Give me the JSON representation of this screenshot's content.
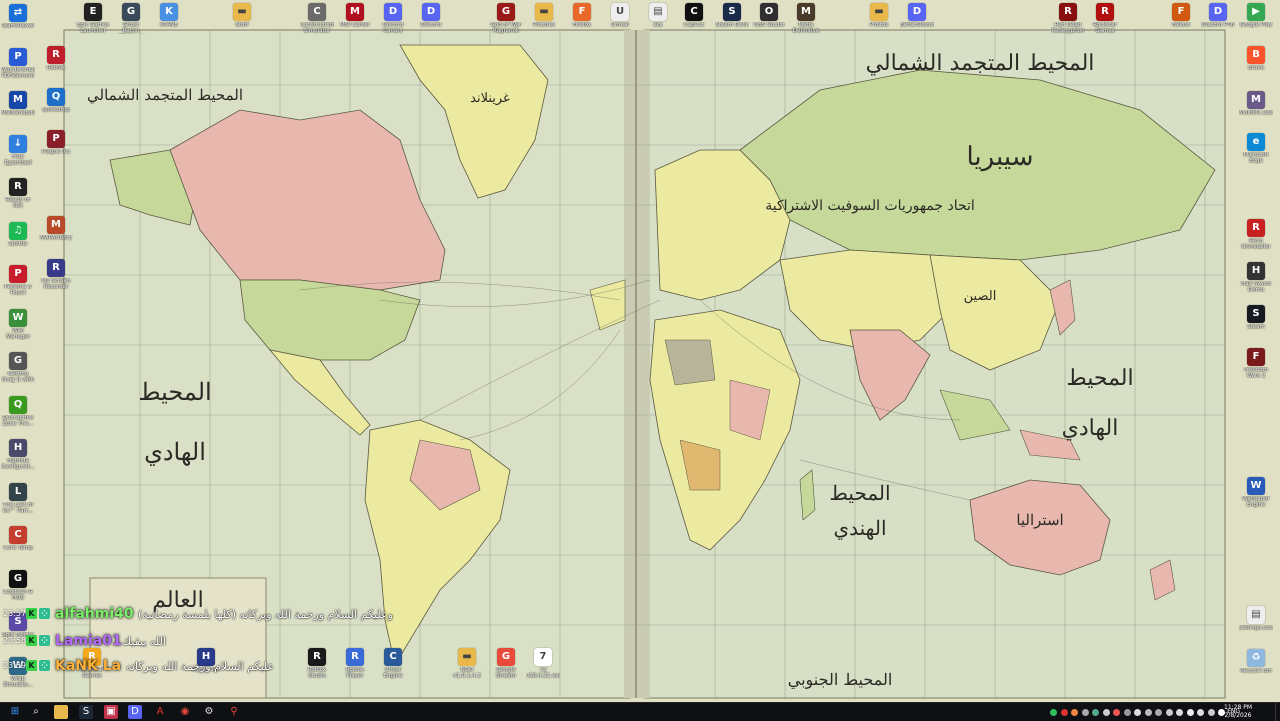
{
  "wallpaper": {
    "labels": {
      "north_atlantic": "المحيط المتجمد الشمالي",
      "north_atlantic_left": "المحيط المتجمد الشمالي",
      "greenland": "غرينلاند",
      "siberia": "سيبريا",
      "ussr": "اتحاد جمهوريات السوفيت الاشتراكية",
      "pacific_left_1": "المحيط",
      "pacific_left_2": "الهادي",
      "pacific_right_1": "المحيط",
      "pacific_right_2": "الهادي",
      "indian_1": "المحيط",
      "indian_2": "الهندي",
      "china": "الصين",
      "australia": "استراليا",
      "southern": "المحيط الجنوبي",
      "title": "العالم"
    }
  },
  "desktop_icons": {
    "left_col": [
      {
        "name": "teamviewer",
        "label": "TeamViewer",
        "color": "#1a6fd9",
        "glyph": "⇄"
      },
      {
        "name": "wondershare",
        "label": "Wondershare PDFelement",
        "color": "#2a5bd7",
        "glyph": "P"
      },
      {
        "name": "malwarebytes",
        "label": "Malwarebytes",
        "color": "#1747a8",
        "glyph": "M"
      },
      {
        "name": "free-download",
        "label": "Free Download Manager",
        "color": "#2f7fe0",
        "glyph": "↓"
      },
      {
        "name": "ready-or-not",
        "label": "Ready or Not",
        "color": "#222",
        "glyph": "R"
      },
      {
        "name": "spotify",
        "label": "Spotify",
        "color": "#1db954",
        "glyph": "♫"
      },
      {
        "name": "persona-5",
        "label": "Persona 5 Royal",
        "color": "#c81e2b",
        "glyph": "P"
      },
      {
        "name": "wiki-manager",
        "label": "Wiki Manager",
        "color": "#3a8f3a",
        "glyph": "W"
      },
      {
        "name": "getting-over-it",
        "label": "Getting Over It with Be...",
        "color": "#555",
        "glyph": "G"
      },
      {
        "name": "quarantine-zone",
        "label": "Quarantine Zone The...",
        "color": "#3a9a20",
        "glyph": "Q"
      },
      {
        "name": "hidhide",
        "label": "HidHide Configurat...",
        "color": "#4a4a6a",
        "glyph": "H"
      },
      {
        "name": "last-of-us",
        "label": "The Last of Us™ Part...",
        "color": "#33434a",
        "glyph": "L"
      },
      {
        "name": "core-temp",
        "label": "Core Temp",
        "color": "#c43d2f",
        "glyph": "C"
      },
      {
        "name": "logitech-g-hub",
        "label": "Logitech G HUB",
        "color": "#111",
        "glyph": "G"
      },
      {
        "name": "split-fiction",
        "label": "Split Fiction",
        "color": "#5b4aa8",
        "glyph": "S"
      },
      {
        "name": "wrap-sim",
        "label": "Wrap Simulato...",
        "color": "#2d6a8a",
        "glyph": "W"
      }
    ],
    "left_col2": [
      {
        "name": "roblox",
        "label": "Roblox",
        "color": "#c01e2a",
        "glyph": "R"
      },
      {
        "name": "quickdrop",
        "label": "quickdrop",
        "color": "#1e6fc8",
        "glyph": "Q"
      },
      {
        "name": "plaguii",
        "label": "Plague Inc",
        "color": "#8a1f2a",
        "glyph": "P"
      },
      {
        "name": "map-app",
        "label": "MAPArtistry",
        "color": "#b84a2a",
        "glyph": "M"
      },
      {
        "name": "my-screen",
        "label": "My Screen Recorder",
        "color": "#3a3a8a",
        "glyph": "R"
      }
    ],
    "top_row": [
      {
        "name": "epic-games",
        "label": "Epic Games Launcher",
        "color": "#222",
        "glyph": "E"
      },
      {
        "name": "ghost-recon",
        "label": "Ghost Recon Wildlands",
        "color": "#3a4a5a",
        "glyph": "G"
      },
      {
        "name": "ktane",
        "label": "KTANE",
        "color": "#4a90e2",
        "glyph": "K"
      },
      {
        "name": "folder-1",
        "label": "Stuff",
        "color": "#e8b84a",
        "glyph": "▬"
      },
      {
        "name": "construction-sim",
        "label": "Construction Simulator",
        "color": "#6a6a6a",
        "glyph": "C"
      },
      {
        "name": "msi-center",
        "label": "MSI Center",
        "color": "#b01020",
        "glyph": "M"
      },
      {
        "name": "discord-1",
        "label": "Discord Canary",
        "color": "#5865f2",
        "glyph": "D"
      },
      {
        "name": "discord-2",
        "label": "Discord",
        "color": "#5865f2",
        "glyph": "D"
      },
      {
        "name": "god-of-war",
        "label": "God of War Ragnarok",
        "color": "#9a1a1a",
        "glyph": "G"
      },
      {
        "name": "folder-2",
        "label": "Pictures",
        "color": "#e8b84a",
        "glyph": "▬"
      },
      {
        "name": "firefox",
        "label": "Firefox",
        "color": "#e8682a",
        "glyph": "F"
      },
      {
        "name": "unnamed",
        "label": "Unreal",
        "color": "#eee",
        "glyph": "U"
      },
      {
        "name": "doc-1",
        "label": "sky",
        "color": "#eee",
        "glyph": "▤"
      },
      {
        "name": "capcut",
        "label": "CapCut",
        "color": "#111",
        "glyph": "C"
      },
      {
        "name": "steam-deck",
        "label": "Steam Deck",
        "color": "#1a2a4a",
        "glyph": "S"
      },
      {
        "name": "obs",
        "label": "OBS Studio",
        "color": "#302e31",
        "glyph": "O"
      },
      {
        "name": "mafia",
        "label": "Mafia Definitive",
        "color": "#4a3a2a",
        "glyph": "M"
      },
      {
        "name": "folder-3",
        "label": "Photos",
        "color": "#e8b84a",
        "glyph": "▬"
      },
      {
        "name": "discord-3",
        "label": "BetterDiscord",
        "color": "#5865f2",
        "glyph": "D"
      },
      {
        "name": "red-dead",
        "label": "Red Dead Redemption 2",
        "color": "#8a1010",
        "glyph": "R"
      },
      {
        "name": "rdr-car",
        "label": "Rockstar Games",
        "color": "#b01010",
        "glyph": "R"
      },
      {
        "name": "fallout",
        "label": "Fallout",
        "color": "#d05a10",
        "glyph": "F"
      },
      {
        "name": "discord-4",
        "label": "Discord PTB",
        "color": "#5865f2",
        "glyph": "D"
      }
    ],
    "right_col": [
      {
        "name": "google-play",
        "label": "Google Play",
        "color": "#34a853",
        "glyph": "▶"
      },
      {
        "name": "brave",
        "label": "Brave",
        "color": "#fb542b",
        "glyph": "B"
      },
      {
        "name": "multi-mc",
        "label": "MultiMC.exe",
        "color": "#6a5a8a",
        "glyph": "M"
      },
      {
        "name": "microsoft-edge",
        "label": "Microsoft Edge",
        "color": "#0c8ad6",
        "glyph": "e"
      },
      {
        "name": "revo",
        "label": "Revo Uninstaller",
        "color": "#c82020",
        "glyph": "R"
      },
      {
        "name": "steam-deck-2",
        "label": "Half Sword Demo",
        "color": "#333",
        "glyph": "H"
      },
      {
        "name": "steam",
        "label": "Steam",
        "color": "#171a21",
        "glyph": "S"
      },
      {
        "name": "hearts-of-iron",
        "label": "Freedom Wars 2",
        "color": "#7a1a1a",
        "glyph": "F"
      },
      {
        "name": "wallpaper-engine",
        "label": "Wallpaper Engine",
        "color": "#2a5ab8",
        "glyph": "W"
      },
      {
        "name": "text-doc",
        "label": "settings.cock",
        "color": "#eee",
        "glyph": "▤"
      },
      {
        "name": "recycle-bin",
        "label": "Recycle Bin",
        "color": "#8fb8e0",
        "glyph": "♻"
      }
    ],
    "bottom_row": [
      {
        "name": "rockstar",
        "label": "Rockstar Games",
        "color": "#f4a81d",
        "glyph": "R"
      },
      {
        "name": "hyper-sim",
        "label": "Hyper Sim",
        "color": "#2a3a8a",
        "glyph": "H"
      },
      {
        "name": "roblox-studio",
        "label": "Roblox Studio",
        "color": "#1a1a1a",
        "glyph": "R"
      },
      {
        "name": "roblox-player",
        "label": "Roblox Player",
        "color": "#3a6ad8",
        "glyph": "R"
      },
      {
        "name": "cheat-engine",
        "label": "Cheat Engine",
        "color": "#2a5a9a",
        "glyph": "C"
      },
      {
        "name": "folder-4",
        "label": "NGO v1.0.1.4.2",
        "color": "#e8b84a",
        "glyph": "▬"
      },
      {
        "name": "google-stream",
        "label": "Google Stream",
        "color": "#e84a3a",
        "glyph": "G"
      },
      {
        "name": "7zip",
        "label": "7Z v18.4.21.exe",
        "color": "#fff",
        "glyph": "7"
      }
    ]
  },
  "chat": [
    {
      "time": "23:57",
      "user": "alfahmi40",
      "user_color": "#7df06a",
      "message": "وعليكم السلام ورحمة الله وبركاته (كلها بلمسة رمضانية)"
    },
    {
      "time": "23:58",
      "user": "Lamia01",
      "user_color": "#b66bff",
      "message": "الله يبقيك"
    },
    {
      "time": "23:59",
      "user": "KaNK La",
      "user_color": "#ffb23a",
      "message": "عليكم السلام ورحمة الله وبركاته"
    }
  ],
  "taskbar": {
    "buttons": [
      {
        "name": "start-button",
        "glyph": "⊞",
        "color": "#0f1014",
        "fg": "#3aa0ff"
      },
      {
        "name": "search-button",
        "glyph": "⌕",
        "color": "#0f1014",
        "fg": "#fff"
      },
      {
        "name": "file-explorer",
        "glyph": "▬",
        "color": "#e8b84a",
        "fg": "#e8b84a"
      },
      {
        "name": "steam-taskbar",
        "glyph": "S",
        "color": "#1b2838",
        "fg": "#fff"
      },
      {
        "name": "app-red",
        "glyph": "▣",
        "color": "#c0324a",
        "fg": "#fff"
      },
      {
        "name": "discord-taskbar",
        "glyph": "D",
        "color": "#5865f2",
        "fg": "#fff"
      },
      {
        "name": "adobe",
        "glyph": "A",
        "color": "#0f1014",
        "fg": "#e8322a"
      },
      {
        "name": "chrome",
        "glyph": "◉",
        "color": "#0f1014",
        "fg": "#e84a3a"
      },
      {
        "name": "settings-gear",
        "glyph": "⚙",
        "color": "#0f1014",
        "fg": "#ddd"
      },
      {
        "name": "maps-pin",
        "glyph": "⚲",
        "color": "#0f1014",
        "fg": "#e84a3a"
      }
    ],
    "language": "ENG",
    "time": "11:28 PM",
    "date": "2/8/2026"
  }
}
